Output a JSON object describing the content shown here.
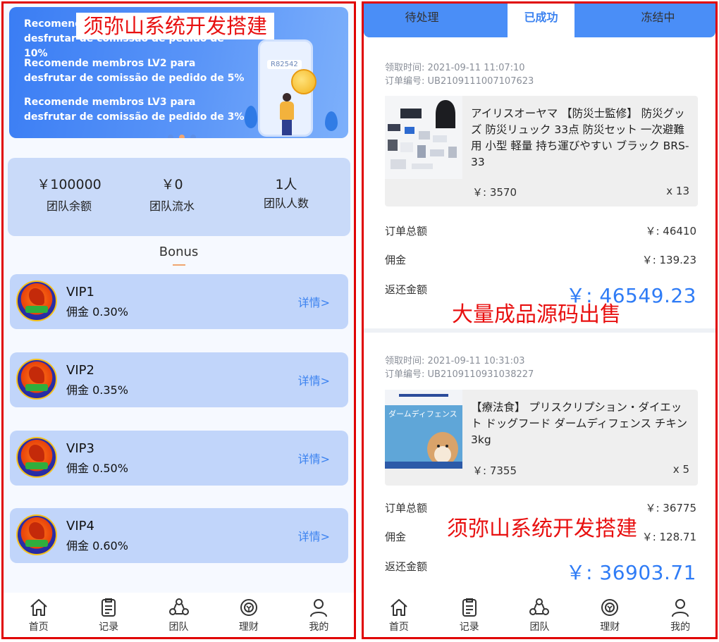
{
  "watermarks": {
    "top_left": "须弥山系统开发搭建",
    "middle_right": "大量成品源码出售",
    "bottom_right": "须弥山系统开发搭建"
  },
  "banner": {
    "lines": [
      "Recomende membros LV1 para desfrutar de comissão de pedido de 10%",
      "Recomende membros LV2 para desfrutar de comissão de pedido de 5%",
      "Recomende membros LV3 para desfrutar de comissão de pedido de 3%"
    ],
    "phone_code": "R82542"
  },
  "stats": [
    {
      "value": "￥100000",
      "label": "团队余额"
    },
    {
      "value": "￥0",
      "label": "团队流水"
    },
    {
      "value": "1人",
      "label": "团队人数"
    }
  ],
  "bonus": {
    "title": "Bonus",
    "detail_label": "详情>",
    "levels": [
      {
        "name": "VIP1",
        "rate": "佣金 0.30%"
      },
      {
        "name": "VIP2",
        "rate": "佣金 0.35%"
      },
      {
        "name": "VIP3",
        "rate": "佣金 0.50%"
      },
      {
        "name": "VIP4",
        "rate": "佣金 0.60%"
      }
    ]
  },
  "nav": [
    {
      "label": "首页",
      "icon": "home-icon"
    },
    {
      "label": "记录",
      "icon": "clipboard-icon"
    },
    {
      "label": "团队",
      "icon": "team-icon"
    },
    {
      "label": "理财",
      "icon": "finance-icon"
    },
    {
      "label": "我的",
      "icon": "user-icon"
    }
  ],
  "tabs": [
    "待处理",
    "已成功",
    "冻结中"
  ],
  "active_tab": "已成功",
  "orders": [
    {
      "claim_time": "领取时间:  2021-09-11 11:07:10",
      "order_no": "订单编号:  UB2109111007107623",
      "title": "アイリスオーヤマ 【防災士監修】 防災グッズ 防災リュック 33点 防災セット 一次避難用 小型 軽量 持ち運びやすい ブラック BRS-33",
      "price": "￥: 3570",
      "qty": "x 13",
      "total_label": "订单总额",
      "total_value": "￥: 46410",
      "commission_label": "佣金",
      "commission_value": "￥: 139.23",
      "refund_label": "返还金额",
      "refund_value": "￥: 46549.23"
    },
    {
      "claim_time": "领取时间:  2021-09-11 10:31:03",
      "order_no": "订单编号:  UB2109110931038227",
      "title": "【療法食】 プリスクリプション・ダイエット ドッグフード ダームディフェンス チキン 3kg",
      "image_text": "ダームディフェンス",
      "price": "￥: 7355",
      "qty": "x 5",
      "total_label": "订单总额",
      "total_value": "￥: 36775",
      "commission_label": "佣金",
      "commission_value": "￥: 128.71",
      "refund_label": "返还金额",
      "refund_value": "￥: 36903.71"
    }
  ],
  "colors": {
    "accent": "#3b82f0",
    "tab_bar": "#4a8ef7",
    "frame_border": "#e00000",
    "card_bg": "#c1d5fa"
  }
}
